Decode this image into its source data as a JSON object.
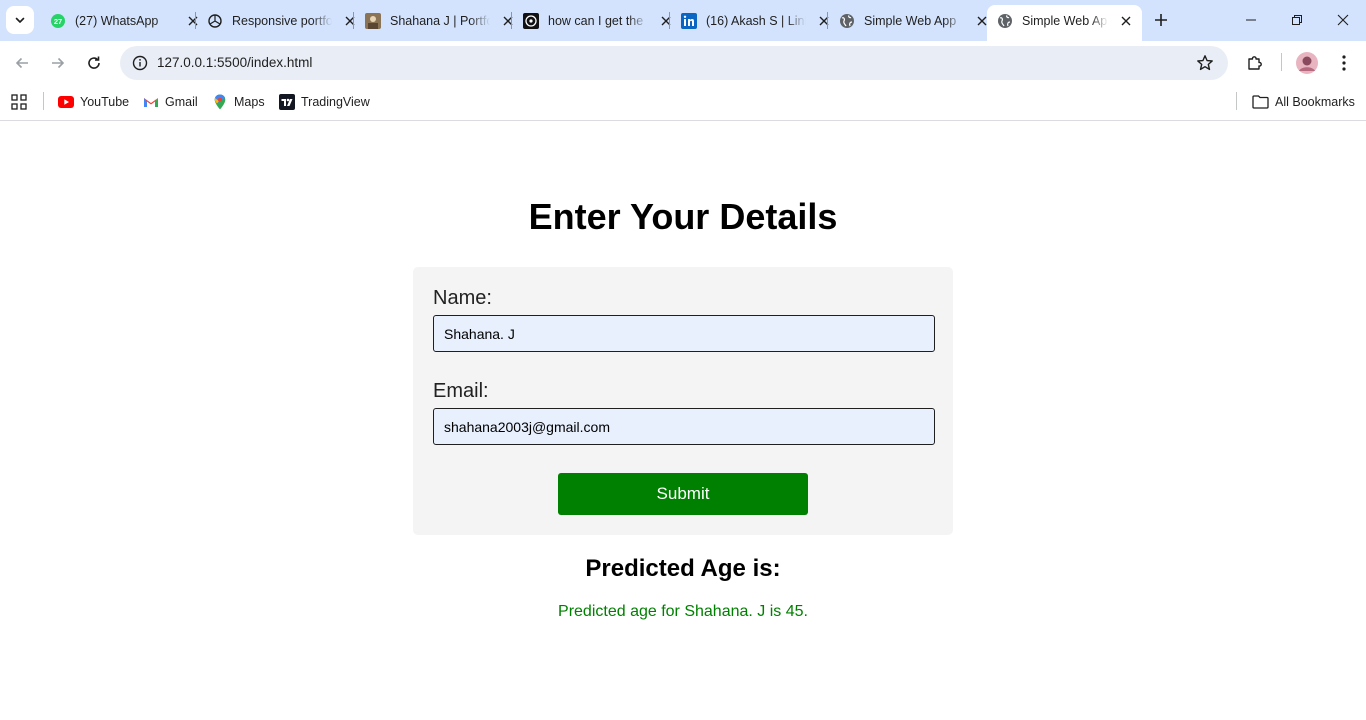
{
  "browser": {
    "tabs": [
      {
        "title": "(27) WhatsApp",
        "icon": "whatsapp-icon",
        "badge": "27"
      },
      {
        "title": "Responsive portfolio",
        "icon": "chatgpt-icon"
      },
      {
        "title": "Shahana J | Portfolio",
        "icon": "portfolio-thumbnail-icon"
      },
      {
        "title": "how can I get the",
        "icon": "github-icon"
      },
      {
        "title": "(16) Akash S | LinkedIn",
        "icon": "linkedin-icon"
      },
      {
        "title": "Simple Web App",
        "icon": "globe-icon"
      },
      {
        "title": "Simple Web App",
        "icon": "globe-icon",
        "active": true
      }
    ],
    "address": {
      "url": "127.0.0.1:5500/index.html"
    },
    "bookmarks": [
      {
        "label": "YouTube",
        "icon": "youtube-icon"
      },
      {
        "label": "Gmail",
        "icon": "gmail-icon"
      },
      {
        "label": "Maps",
        "icon": "maps-icon"
      },
      {
        "label": "TradingView",
        "icon": "tradingview-icon"
      }
    ],
    "all_bookmarks_label": "All Bookmarks"
  },
  "page": {
    "heading": "Enter Your Details",
    "form": {
      "name_label": "Name:",
      "name_value": "Shahana. J",
      "email_label": "Email:",
      "email_value": "shahana2003j@gmail.com",
      "submit_label": "Submit"
    },
    "result": {
      "title": "Predicted Age is:",
      "text": "Predicted age for Shahana. J is 45."
    }
  },
  "colors": {
    "accent": "#008000",
    "tabstrip": "#d3e3fd",
    "omnibox": "#e9eef6",
    "input_fill": "#e8f0fe",
    "card": "#f4f4f4"
  }
}
